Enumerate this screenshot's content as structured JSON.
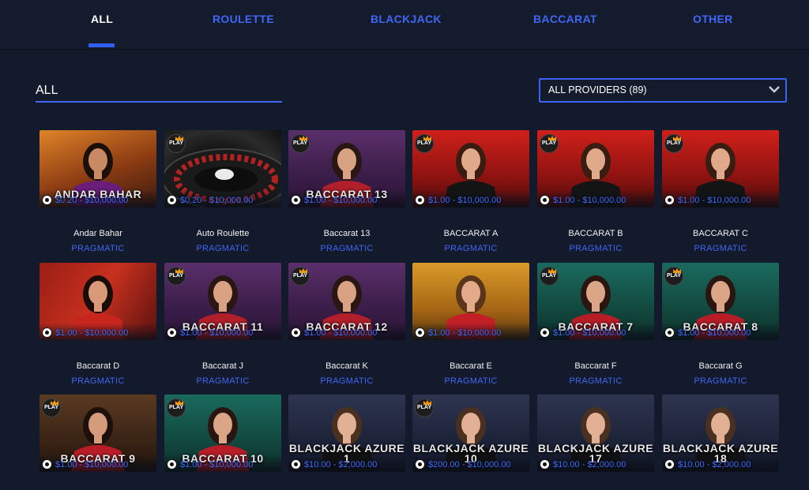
{
  "nav": {
    "tabs": [
      {
        "label": "ALL"
      },
      {
        "label": "ROULETTE"
      },
      {
        "label": "BLACKJACK"
      },
      {
        "label": "BACCARAT"
      },
      {
        "label": "OTHER"
      }
    ]
  },
  "filters": {
    "search_value": "ALL",
    "provider_select": "ALL PROVIDERS (89)"
  },
  "badge_label": "PLAY",
  "colors": {
    "accent": "#3f66f5",
    "background": "#131a2b"
  },
  "games": [
    {
      "name": "Andar Bahar",
      "provider": "PRAGMATIC",
      "thumb_title": "ANDAR BAHAR",
      "bet_range": "$0.20 - $10,000.00",
      "theme": "orange",
      "badge": false
    },
    {
      "name": "Auto Roulette",
      "provider": "PRAGMATIC",
      "thumb_title": "",
      "bet_range": "$0.20 - $10,000.00",
      "theme": "roulette",
      "badge": true
    },
    {
      "name": "Baccarat 13",
      "provider": "PRAGMATIC",
      "thumb_title": "BACCARAT 13",
      "bet_range": "$1.00 - $10,000.00",
      "theme": "purple",
      "badge": true
    },
    {
      "name": "BACCARAT A",
      "provider": "PRAGMATIC",
      "thumb_title": "",
      "bet_range": "$1.00 - $10,000.00",
      "theme": "red",
      "badge": true
    },
    {
      "name": "BACCARAT B",
      "provider": "PRAGMATIC",
      "thumb_title": "",
      "bet_range": "$1.00 - $10,000.00",
      "theme": "red",
      "badge": true
    },
    {
      "name": "BACCARAT C",
      "provider": "PRAGMATIC",
      "thumb_title": "",
      "bet_range": "$1.00 - $10,000.00",
      "theme": "red",
      "badge": true
    },
    {
      "name": "Baccarat D",
      "provider": "PRAGMATIC",
      "thumb_title": "",
      "bet_range": "$1.00 - $10,000.00",
      "theme": "redroom",
      "badge": false
    },
    {
      "name": "Baccarat J",
      "provider": "PRAGMATIC",
      "thumb_title": "BACCARAT 11",
      "bet_range": "$1.00 - $10,000.00",
      "theme": "purple",
      "badge": true
    },
    {
      "name": "Baccarat K",
      "provider": "PRAGMATIC",
      "thumb_title": "BACCARAT 12",
      "bet_range": "$1.00 - $10,000.00",
      "theme": "purple",
      "badge": true
    },
    {
      "name": "Baccarat E",
      "provider": "PRAGMATIC",
      "thumb_title": "",
      "bet_range": "$1.00 - $10,000.00",
      "theme": "gold",
      "badge": false
    },
    {
      "name": "Baccarat F",
      "provider": "PRAGMATIC",
      "thumb_title": "BACCARAT 7",
      "bet_range": "$1.00 - $10,000.00",
      "theme": "green",
      "badge": true
    },
    {
      "name": "Baccarat G",
      "provider": "PRAGMATIC",
      "thumb_title": "BACCARAT 8",
      "bet_range": "$1.00 - $10,000.00",
      "theme": "green",
      "badge": true
    },
    {
      "name": "",
      "provider": "",
      "thumb_title": "BACCARAT 9",
      "bet_range": "$1.00 - $10,000.00",
      "theme": "bronze",
      "badge": true
    },
    {
      "name": "",
      "provider": "",
      "thumb_title": "BACCARAT 10",
      "bet_range": "$1.00 - $10,000.00",
      "theme": "green",
      "badge": true
    },
    {
      "name": "",
      "provider": "",
      "thumb_title": "BLACKJACK AZURE 1",
      "bet_range": "$10.00 - $2,000.00",
      "theme": "azure",
      "badge": false
    },
    {
      "name": "",
      "provider": "",
      "thumb_title": "BLACKJACK AZURE 10",
      "bet_range": "$200.00 - $10,000.00",
      "theme": "azure",
      "badge": true
    },
    {
      "name": "",
      "provider": "",
      "thumb_title": "BLACKJACK AZURE 17",
      "bet_range": "$10.00 - $2,000.00",
      "theme": "azure",
      "badge": false
    },
    {
      "name": "",
      "provider": "",
      "thumb_title": "BLACKJACK AZURE 18",
      "bet_range": "$10.00 - $2,000.00",
      "theme": "azure",
      "badge": false
    }
  ]
}
